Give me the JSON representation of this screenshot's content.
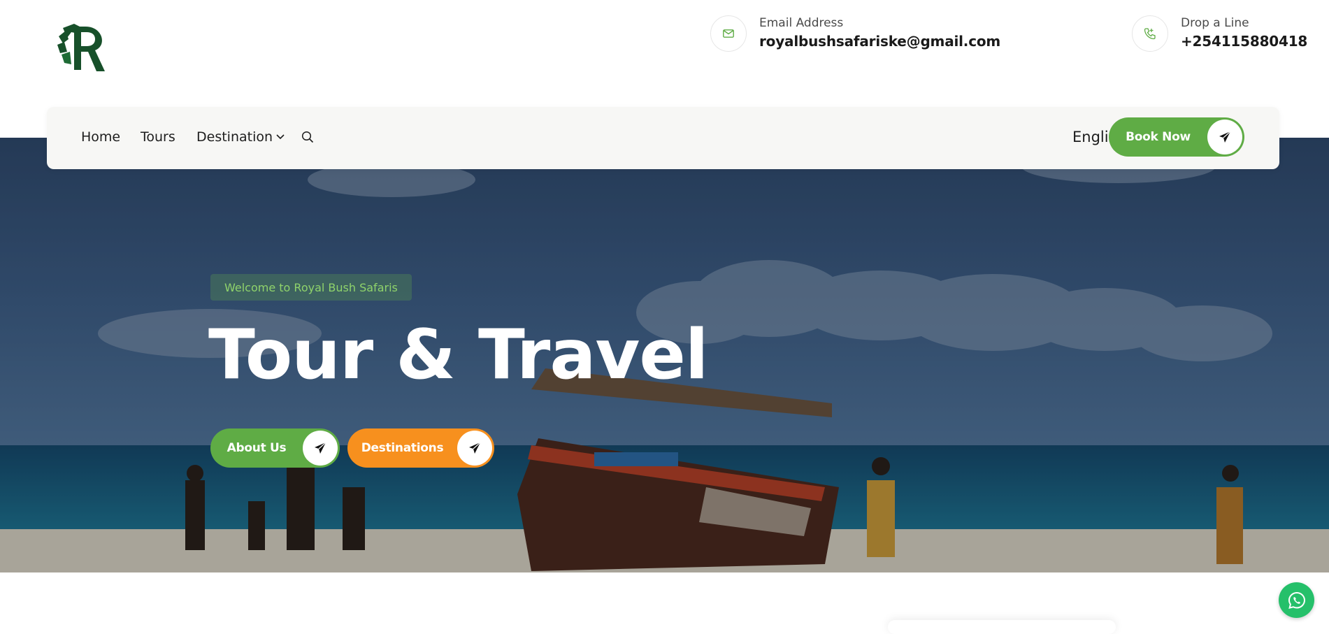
{
  "brand": {
    "logo_text": "Royal Bush Safaris",
    "logo_icon": "lion-r-logo",
    "primary_color": "#5fac45",
    "accent_color": "#f7901e"
  },
  "contact": {
    "email": {
      "label": "Email Address",
      "value": "royalbushsafariske@gmail.com",
      "icon": "envelope-icon"
    },
    "phone": {
      "label": "Drop a Line",
      "value": "+254115880418",
      "icon": "phone-icon"
    }
  },
  "nav": {
    "items": [
      {
        "label": "Home"
      },
      {
        "label": "Tours"
      },
      {
        "label": "Destination",
        "has_dropdown": true
      }
    ],
    "search_icon": "search-icon",
    "language": "English",
    "book_label": "Book Now"
  },
  "hero": {
    "badge": "Welcome to Royal Bush Safaris",
    "title": "Tour & Travel",
    "buttons": [
      {
        "label": "About Us",
        "color": "#5fac45"
      },
      {
        "label": "Destinations",
        "color": "#f7901e"
      }
    ]
  },
  "floating": {
    "whatsapp_icon": "whatsapp-icon"
  }
}
